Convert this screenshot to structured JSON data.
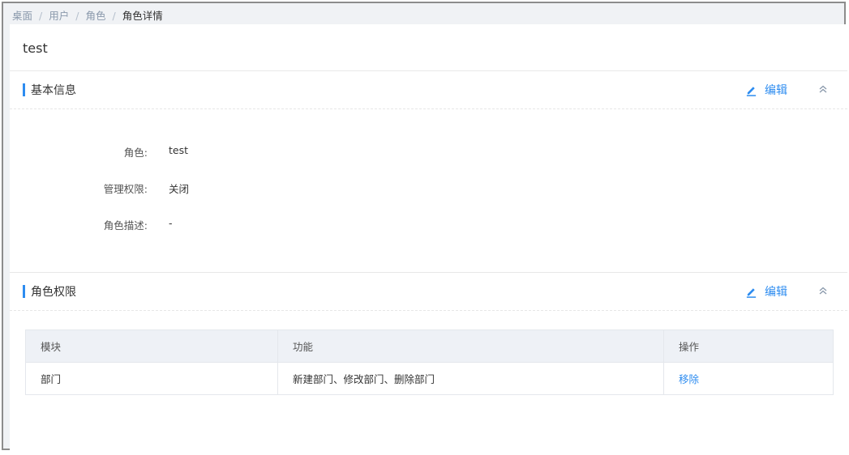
{
  "breadcrumb": {
    "items": [
      "桌面",
      "用户",
      "角色"
    ],
    "current": "角色详情",
    "separator": "/"
  },
  "page_title": "test",
  "basic_info": {
    "title": "基本信息",
    "edit_label": "编辑",
    "fields": [
      {
        "label": "角色:",
        "value": "test"
      },
      {
        "label": "管理权限:",
        "value": "关闭"
      },
      {
        "label": "角色描述:",
        "value": "-"
      }
    ]
  },
  "permissions": {
    "title": "角色权限",
    "edit_label": "编辑",
    "columns": [
      "模块",
      "功能",
      "操作"
    ],
    "rows": [
      {
        "module": "部门",
        "features": "新建部门、修改部门、删除部门",
        "action": "移除"
      }
    ]
  },
  "colors": {
    "accent": "#2d8cf0",
    "header_bg": "#eef1f6",
    "page_bg": "#f0f2f5"
  },
  "icons": [
    "pencil-icon",
    "double-chevron-up-icon"
  ]
}
